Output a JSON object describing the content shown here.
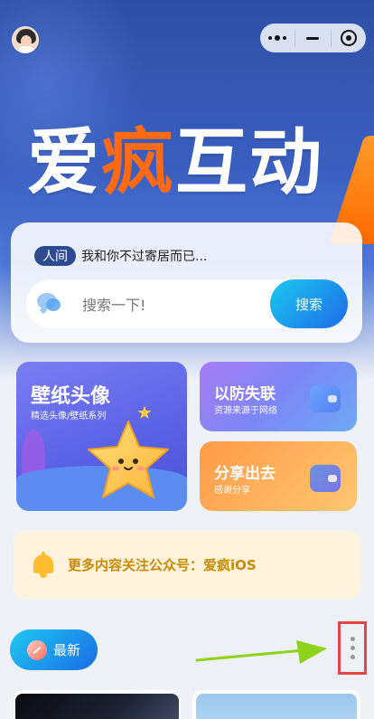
{
  "brand": {
    "char1": "爱",
    "char2": "疯",
    "char3": "互",
    "char4": "动"
  },
  "notice": {
    "tag": "人间",
    "text": "我和你不过寄居而已..."
  },
  "search": {
    "placeholder": "搜索一下!",
    "button": "搜索"
  },
  "cards": {
    "wallpaper": {
      "title": "壁纸头像",
      "subtitle": "精选头像/壁纸系列"
    },
    "fang": {
      "title": "以防失联",
      "subtitle": "资源来源于网络"
    },
    "share": {
      "title": "分享出去",
      "subtitle": "感谢分享"
    }
  },
  "banner": {
    "text": "更多内容关注公众号：爱疯iOS"
  },
  "tabs": {
    "latest": "最新"
  },
  "colors": {
    "hero_blue": "#2e4fa6",
    "brand_orange": "#ff6a13",
    "search_button": "#1d6be8",
    "banner_text": "#c88a00",
    "highlight_red": "#e5454a",
    "arrow_green": "#8fd21a"
  },
  "icons": {
    "capsule_more": "more-dots-icon",
    "capsule_minimize": "minimize-icon",
    "capsule_close": "target-close-icon",
    "search": "chat-bubble-icon",
    "notice": "bell-icon",
    "latest": "leaf-icon",
    "more": "vertical-dots-icon"
  }
}
